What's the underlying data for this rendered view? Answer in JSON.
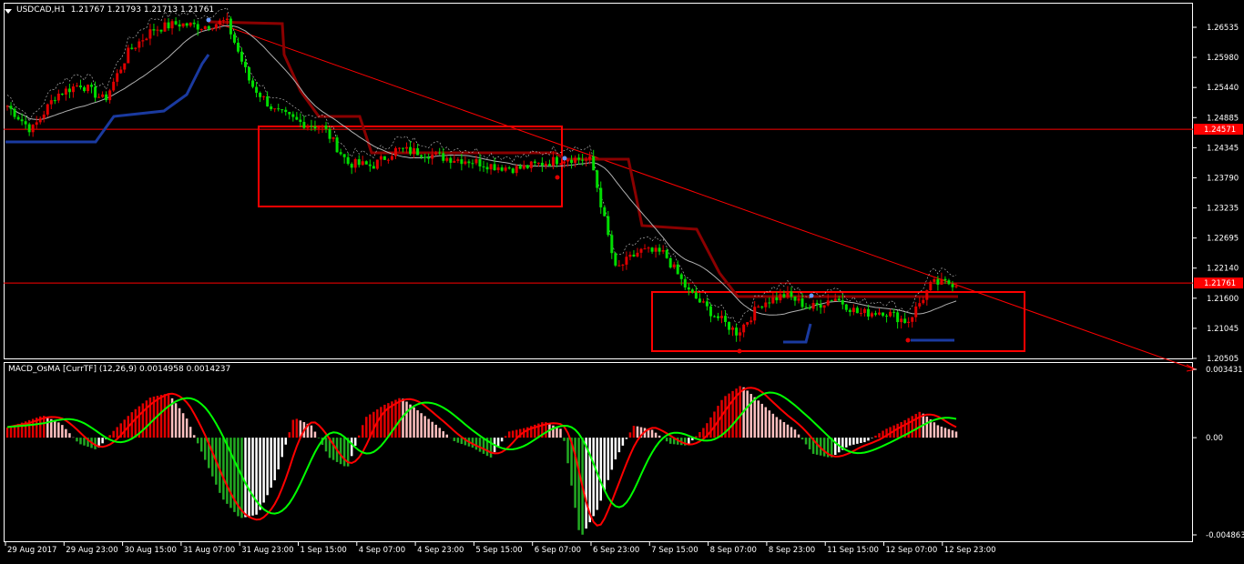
{
  "window": {
    "symbol_title": "USDCAD,H1",
    "ohlc": "1.21767 1.21793 1.21713 1.21761",
    "subtitle": "MACD_OsMA [CurrTF] (12,26,9) 0.0014958 0.0014237"
  },
  "price_axis": {
    "ticks": [
      "1.26535",
      "1.25980",
      "1.25440",
      "1.24885",
      "1.24345",
      "1.23790",
      "1.23235",
      "1.22695",
      "1.22140",
      "1.21600",
      "1.21045",
      "1.20505"
    ],
    "line_label_1": "1.24571",
    "line_label_2": "1.21761"
  },
  "macd_axis": {
    "ticks": [
      "0.003431",
      "0.00",
      "-0.004863"
    ]
  },
  "time_axis": {
    "labels": [
      "29 Aug 2017",
      "29 Aug 23:00",
      "30 Aug 15:00",
      "31 Aug 07:00",
      "31 Aug 23:00",
      "1 Sep 15:00",
      "4 Sep 07:00",
      "4 Sep 23:00",
      "5 Sep 15:00",
      "6 Sep 07:00",
      "6 Sep 23:00",
      "7 Sep 15:00",
      "8 Sep 07:00",
      "8 Sep 23:00",
      "11 Sep 15:00",
      "12 Sep 07:00",
      "12 Sep 23:00"
    ]
  },
  "colors": {
    "background": "#000000",
    "bull": "#e00000",
    "bear": "#00dd00",
    "stop_line": "#8b0000",
    "support_line": "#1a3aa0",
    "box": "#ff0000",
    "hline": "#ff0000",
    "ma": "#b0b0b0",
    "macd_main": "#ff0000",
    "macd_signal": "#00ff00",
    "hist_up_strong": "#e00000",
    "hist_up_weak": "#ffc0c0",
    "hist_down_strong": "#22aa22",
    "hist_down_weak": "#ffffff"
  },
  "chart_data": [
    {
      "type": "candlestick",
      "title": "USDCAD,H1",
      "x": [
        "29 Aug 2017",
        "29 Aug 23:00",
        "30 Aug 15:00",
        "31 Aug 07:00",
        "31 Aug 23:00",
        "1 Sep 15:00",
        "4 Sep 07:00",
        "4 Sep 23:00",
        "5 Sep 15:00",
        "6 Sep 07:00",
        "6 Sep 23:00",
        "7 Sep 15:00",
        "8 Sep 07:00",
        "8 Sep 23:00",
        "11 Sep 15:00",
        "12 Sep 07:00",
        "12 Sep 23:00"
      ],
      "close_path": [
        1.25,
        1.2455,
        1.252,
        1.254,
        1.251,
        1.26,
        1.264,
        1.265,
        1.2645,
        1.2655,
        1.254,
        1.249,
        1.247,
        1.246,
        1.2395,
        1.239,
        1.242,
        1.2415,
        1.2405,
        1.24,
        1.239,
        1.2385,
        1.2395,
        1.2405,
        1.24,
        1.22,
        1.2235,
        1.223,
        1.216,
        1.212,
        1.2085,
        1.214,
        1.2155,
        1.213,
        1.215,
        1.212,
        1.2125,
        1.2105,
        1.2175,
        1.2176
      ],
      "ylim": [
        1.204,
        1.2685
      ],
      "horizontal_lines": [
        1.24571,
        1.21761
      ]
    },
    {
      "type": "bar",
      "title": "MACD_OsMA [CurrTF] (12,26,9)",
      "main": 0.0014958,
      "signal": 0.0014237,
      "histogram": [
        0.0005,
        0.0008,
        0.0011,
        0.0007,
        -0.0003,
        -0.0006,
        0.0004,
        0.0013,
        0.002,
        0.0022,
        0.001,
        -0.001,
        -0.003,
        -0.004,
        -0.0038,
        -0.002,
        0.001,
        0.0006,
        -0.001,
        -0.0015,
        0.001,
        0.0016,
        0.002,
        0.0013,
        0.0006,
        -0.0002,
        -0.0005,
        -0.001,
        0.0003,
        0.0005,
        0.0008,
        0.0004,
        -0.005,
        -0.0035,
        -0.001,
        0.0006,
        0.0004,
        -0.0003,
        -0.0004,
        0.0006,
        0.002,
        0.0026,
        0.0018,
        0.001,
        0.0004,
        -0.0008,
        -0.001,
        -0.0004,
        -0.0002,
        0.0004,
        0.0008,
        0.0013,
        0.0006,
        0.0003
      ],
      "ylim": [
        -0.004863,
        0.003431
      ]
    }
  ]
}
